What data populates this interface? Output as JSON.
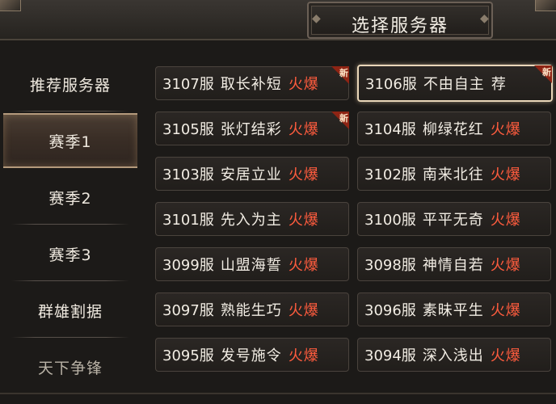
{
  "header": {
    "title": "选择服务器"
  },
  "sidebar": {
    "items": [
      {
        "label": "推荐服务器",
        "active": false
      },
      {
        "label": "赛季1",
        "active": true
      },
      {
        "label": "赛季2",
        "active": false
      },
      {
        "label": "赛季3",
        "active": false
      },
      {
        "label": "群雄割据",
        "active": false
      },
      {
        "label": "天下争锋",
        "active": false
      }
    ]
  },
  "servers": [
    {
      "number": "3107服",
      "name": "取长补短",
      "status": "火爆",
      "status_type": "hot",
      "badge": "新"
    },
    {
      "number": "3106服",
      "name": "不由自主",
      "status": "荐",
      "status_type": "rec",
      "badge": "新",
      "selected": true
    },
    {
      "number": "3105服",
      "name": "张灯结彩",
      "status": "火爆",
      "status_type": "hot",
      "badge": "新"
    },
    {
      "number": "3104服",
      "name": "柳绿花红",
      "status": "火爆",
      "status_type": "hot"
    },
    {
      "number": "3103服",
      "name": "安居立业",
      "status": "火爆",
      "status_type": "hot"
    },
    {
      "number": "3102服",
      "name": "南来北往",
      "status": "火爆",
      "status_type": "hot"
    },
    {
      "number": "3101服",
      "name": "先入为主",
      "status": "火爆",
      "status_type": "hot"
    },
    {
      "number": "3100服",
      "name": "平平无奇",
      "status": "火爆",
      "status_type": "hot"
    },
    {
      "number": "3099服",
      "name": "山盟海誓",
      "status": "火爆",
      "status_type": "hot"
    },
    {
      "number": "3098服",
      "name": "神情自若",
      "status": "火爆",
      "status_type": "hot"
    },
    {
      "number": "3097服",
      "name": "熟能生巧",
      "status": "火爆",
      "status_type": "hot"
    },
    {
      "number": "3096服",
      "name": "素昧平生",
      "status": "火爆",
      "status_type": "hot"
    },
    {
      "number": "3095服",
      "name": "发号施令",
      "status": "火爆",
      "status_type": "hot"
    },
    {
      "number": "3094服",
      "name": "深入浅出",
      "status": "火爆",
      "status_type": "hot"
    }
  ],
  "colors": {
    "hot": "#ff5c3e",
    "badge": "#8e2414",
    "frame": "#4a433d"
  }
}
